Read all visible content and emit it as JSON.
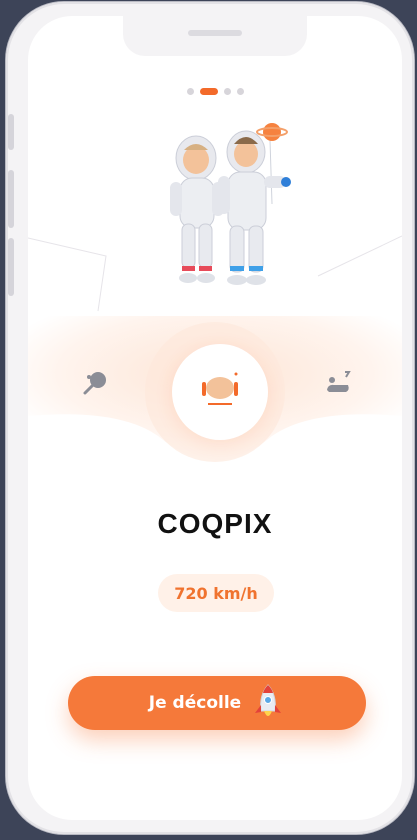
{
  "carousel": {
    "pages": 4,
    "active_index": 1
  },
  "character": {
    "name": "COQPIX"
  },
  "stats": {
    "speed": "720 km/h"
  },
  "cta": {
    "label": "Je décolle"
  },
  "icons": {
    "left": "lollipop-icon",
    "center": "helmet-icon",
    "right": "rocket-sled-icon",
    "cta": "rocket-icon"
  },
  "colors": {
    "accent": "#f5793a",
    "accent_light": "#fff1e8",
    "text": "#111111",
    "dot_inactive": "#d7d5da"
  }
}
